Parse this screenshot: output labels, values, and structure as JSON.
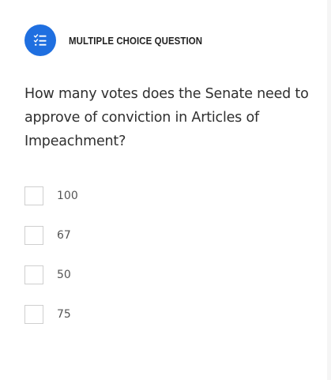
{
  "question_type": {
    "icon": "checklist-icon",
    "label": "MULTIPLE CHOICE QUESTION",
    "accent_color": "#1f6fe0"
  },
  "question": {
    "text": "How many votes does the Senate need to approve of conviction in Articles of Impeachment?"
  },
  "options": [
    {
      "label": "100",
      "checked": false
    },
    {
      "label": "67",
      "checked": false
    },
    {
      "label": "50",
      "checked": false
    },
    {
      "label": "75",
      "checked": false
    }
  ]
}
